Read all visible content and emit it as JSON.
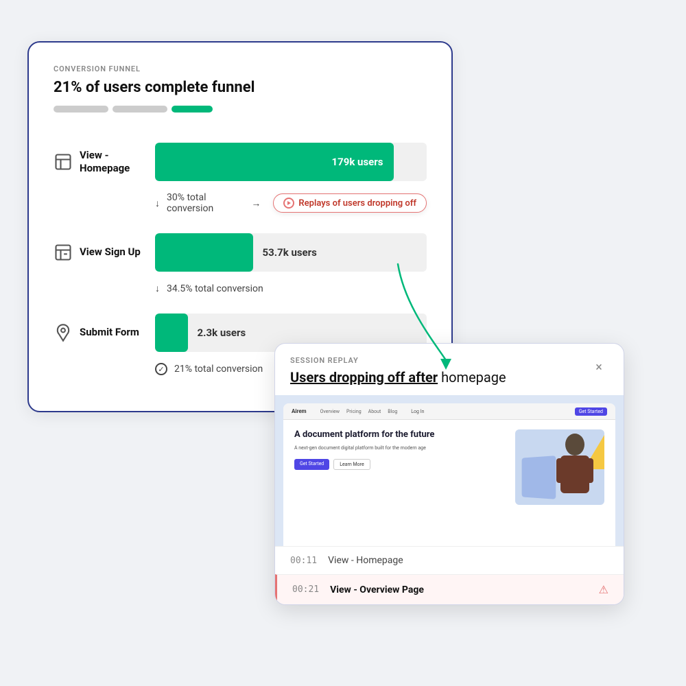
{
  "scene": {
    "funnel_card": {
      "label": "CONVERSION FUNNEL",
      "title": "21% of users complete funnel",
      "progress_segments": [
        {
          "width": 80,
          "color": "#ccc"
        },
        {
          "width": 80,
          "color": "#ccc"
        },
        {
          "width": 60,
          "color": "#00b87a"
        }
      ],
      "steps": [
        {
          "id": "homepage",
          "icon": "page-icon",
          "label": "View -\nHomepage",
          "bar_width_pct": 88,
          "bar_color": "#00b87a",
          "users": "179k users",
          "users_in_bar": true,
          "conversion": "30% total conversion"
        },
        {
          "id": "signup",
          "icon": "signup-icon",
          "label": "View Sign Up",
          "bar_width_pct": 36,
          "bar_color": "#00b87a",
          "users": "53.7k users",
          "users_in_bar": false,
          "conversion": "34.5% total conversion"
        },
        {
          "id": "submit",
          "icon": "form-icon",
          "label": "Submit Form",
          "bar_width_pct": 12,
          "bar_color": "#00b87a",
          "users": "2.3k users",
          "users_in_bar": false,
          "conversion": "21% total conversion"
        }
      ],
      "replay_badge": {
        "text": "Replays of users dropping off"
      }
    },
    "arrow": {
      "description": "curved arrow from replay badge to session card"
    },
    "session_card": {
      "label": "SESSION REPLAY",
      "title_bold": "Users dropping off after",
      "title_rest": " homepage",
      "close_label": "×",
      "preview": {
        "brand": "Airem",
        "nav_links": [
          "Overview",
          "Pricing",
          "About",
          "Blog"
        ],
        "login": "Log In",
        "cta": "Get Started",
        "hero_title": "A document platform for the future",
        "hero_sub": "A next-gen document digital platform built for the modern age",
        "btn_primary": "Get Started",
        "btn_secondary": "Learn More"
      },
      "timeline": [
        {
          "time": "00:11",
          "event": "View - Homepage",
          "active": false
        },
        {
          "time": "00:21",
          "event": "View - Overview Page",
          "active": true
        }
      ]
    }
  }
}
